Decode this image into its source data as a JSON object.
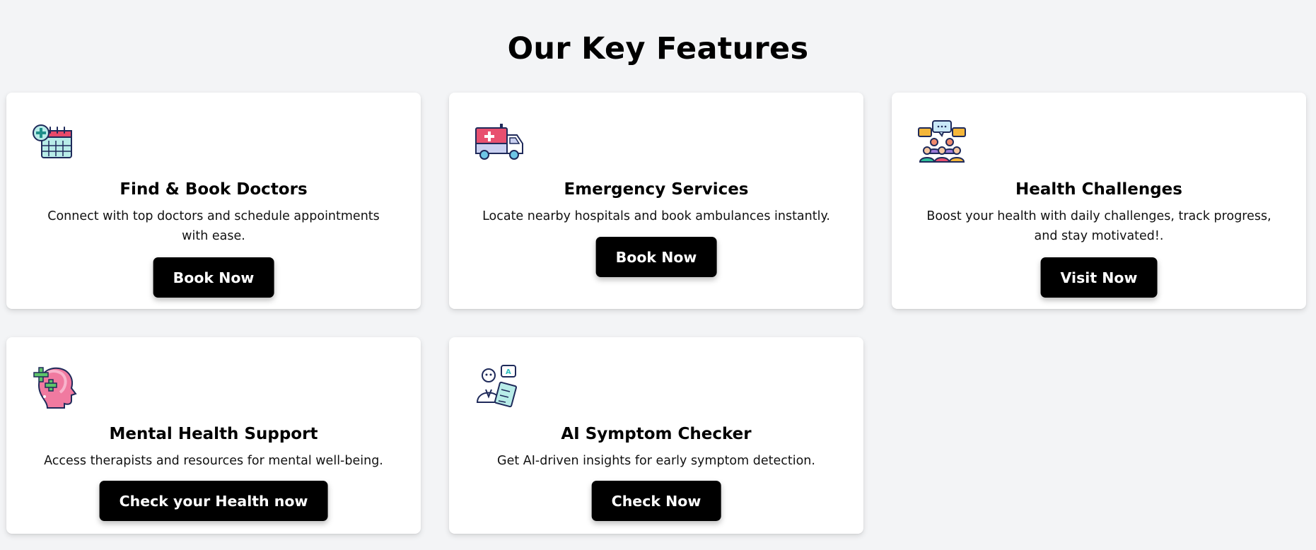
{
  "section": {
    "title": "Our Key Features"
  },
  "features": [
    {
      "icon": "calendar-medical-icon",
      "title": "Find & Book Doctors",
      "description": "Connect with top doctors and schedule appointments with ease.",
      "button_label": "Book Now"
    },
    {
      "icon": "ambulance-icon",
      "title": "Emergency Services",
      "description": "Locate nearby hospitals and book ambulances instantly.",
      "button_label": "Book Now"
    },
    {
      "icon": "group-chat-icon",
      "title": "Health Challenges",
      "description": "Boost your health with daily challenges, track progress, and stay motivated!.",
      "button_label": "Visit Now"
    },
    {
      "icon": "mental-health-head-icon",
      "title": "Mental Health Support",
      "description": "Access therapists and resources for mental well-being.",
      "button_label": "Check your Health now"
    },
    {
      "icon": "ai-doctor-icon",
      "title": "AI Symptom Checker",
      "description": "Get AI-driven insights for early symptom detection.",
      "button_label": "Check Now"
    }
  ]
}
